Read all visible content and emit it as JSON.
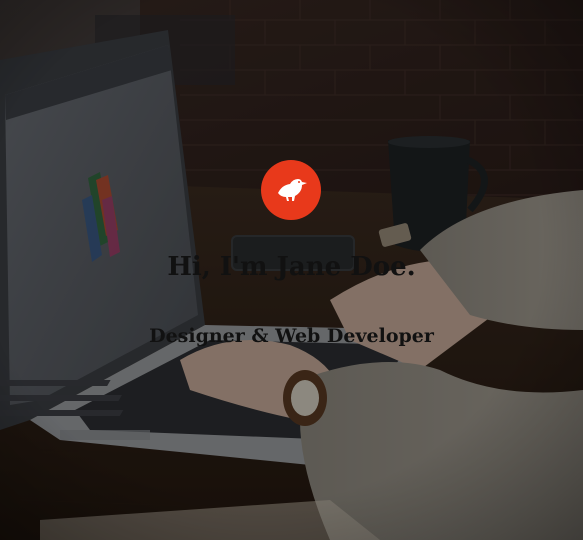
{
  "hero": {
    "headline": "Hi, I'm Jane Doe.",
    "subtitle": "Designer & Web Developer",
    "logo_icon": "bird-icon",
    "logo_color": "#e8391b",
    "text_color": "#111111"
  }
}
